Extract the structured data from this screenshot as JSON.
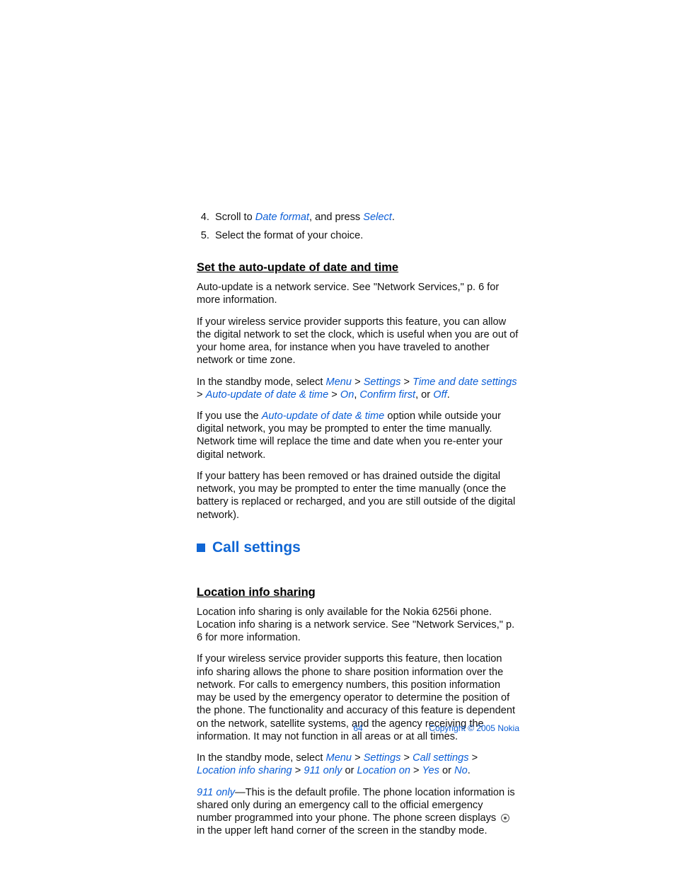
{
  "steps": {
    "start": 4,
    "items": [
      {
        "pre": "Scroll to ",
        "m1": "Date format",
        "mid": ", and press ",
        "m2": "Select",
        "post": "."
      },
      {
        "pre": "Select the format of your choice."
      }
    ]
  },
  "h_auto": "Set the auto-update of date and time",
  "auto_p1": "Auto-update is a network service. See \"Network Services,\" p. 6 for more information.",
  "auto_p2": "If your wireless service provider supports this feature, you can allow the digital network to set the clock, which is useful when you are out of your home area, for instance when you have traveled to another network or time zone.",
  "auto_p3": {
    "pre": "In the standby mode, select ",
    "seq": [
      "Menu",
      "Settings",
      "Time and date settings",
      "Auto-update of date & time"
    ],
    "tail_sep": " > ",
    "tail_seq": [
      "On"
    ],
    "comma": ", ",
    "tail2": "Confirm first",
    "or": ", or ",
    "tail3": "Off",
    "post": "."
  },
  "auto_p4": {
    "pre": "If you use the ",
    "m1": "Auto-update of date & time",
    "post": " option while outside your digital network, you may be prompted to enter the time manually. Network time will replace the time and date when you re-enter your digital network."
  },
  "auto_p5": "If your battery has been removed or has drained outside the digital network, you may be prompted to enter the time manually (once the battery is replaced or recharged, and you are still outside of the digital network).",
  "section_call": "Call settings",
  "h_loc": "Location info sharing",
  "loc_p1": "Location info sharing is only available for the Nokia 6256i phone. Location info sharing is a network service. See \"Network Services,\" p. 6 for more information.",
  "loc_p2": "If your wireless service provider supports this feature, then location info sharing allows the phone to share position information over the network. For calls to emergency numbers, this position information may be used by the emergency operator to determine the position of the phone. The functionality and accuracy of this feature is dependent on the network, satellite systems, and the agency receiving the information. It may not function in all areas or at all times.",
  "loc_p3": {
    "pre": "In the standby mode, select ",
    "seq": [
      "Menu",
      "Settings",
      "Call settings",
      "Location info sharing"
    ],
    "tail_sep": " > ",
    "tail_seq": [
      "911 only"
    ],
    "or1": " or ",
    "m2": "Location on",
    "sep2": " > ",
    "m3": "Yes",
    "or2": " or ",
    "m4": "No",
    "post": "."
  },
  "loc_p4": {
    "m1": "911 only",
    "pre": "—This is the default profile. The phone location information is shared only during an emergency call to the official emergency number programmed into your phone. The phone screen displays ",
    "post": " in the upper left hand corner of the screen in the standby mode."
  },
  "footer": {
    "page": "64",
    "copyright": "Copyright © 2005 Nokia"
  }
}
